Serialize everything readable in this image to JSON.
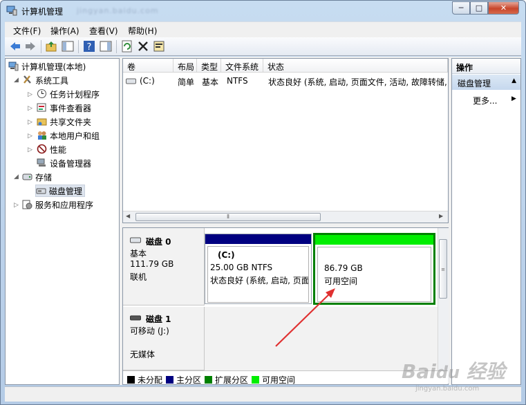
{
  "window": {
    "title": "计算机管理"
  },
  "watermark_url": "jingyan.baidu.com",
  "caption_buttons": {
    "minimize": "─",
    "maximize": "□",
    "close": "✕"
  },
  "menu": [
    "文件(F)",
    "操作(A)",
    "查看(V)",
    "帮助(H)"
  ],
  "toolbar_icons": [
    "back-arrow-icon",
    "forward-arrow-icon",
    "up-folder-icon",
    "show-hide-tree-icon",
    "help-icon",
    "show-hide-action-pane-icon",
    "refresh-icon",
    "delete-icon",
    "properties-icon"
  ],
  "tree": {
    "root": "计算机管理(本地)",
    "system_tools": "系统工具",
    "task_scheduler": "任务计划程序",
    "event_viewer": "事件查看器",
    "shared_folders": "共享文件夹",
    "local_users": "本地用户和组",
    "performance": "性能",
    "device_manager": "设备管理器",
    "storage": "存储",
    "disk_management": "磁盘管理",
    "services_apps": "服务和应用程序"
  },
  "volume_list": {
    "columns": [
      "卷",
      "布局",
      "类型",
      "文件系统",
      "状态"
    ],
    "rows": [
      {
        "volume": "(C:)",
        "layout": "简单",
        "type": "基本",
        "filesystem": "NTFS",
        "status": "状态良好 (系统, 启动, 页面文件, 活动, 故障转储, 主"
      }
    ],
    "scroll_grip": "⦀"
  },
  "disks": [
    {
      "name": "磁盘 0",
      "type": "基本",
      "size": "111.79 GB",
      "state": "联机",
      "partitions": [
        {
          "label": "(C:)",
          "size_fs": "25.00 GB NTFS",
          "status": "状态良好 (系统, 启动, 页面",
          "kind": "primary"
        },
        {
          "label": "",
          "size_fs": "86.79 GB",
          "status": "可用空间",
          "kind": "free"
        }
      ]
    },
    {
      "name": "磁盘 1",
      "type": "可移动 (J:)",
      "size": "",
      "state": "无媒体",
      "partitions": []
    }
  ],
  "legend": [
    {
      "label": "未分配",
      "color": "#000000"
    },
    {
      "label": "主分区",
      "color": "#000080"
    },
    {
      "label": "扩展分区",
      "color": "#008000"
    },
    {
      "label": "可用空间",
      "color": "#00ee00"
    }
  ],
  "actions": {
    "header": "操作",
    "selected": "磁盘管理",
    "more": "更多..."
  },
  "colors": {
    "primary_bar": "#000080",
    "free_bar": "#00ee00",
    "free_border": "#008000",
    "arrow": "#e03030"
  }
}
